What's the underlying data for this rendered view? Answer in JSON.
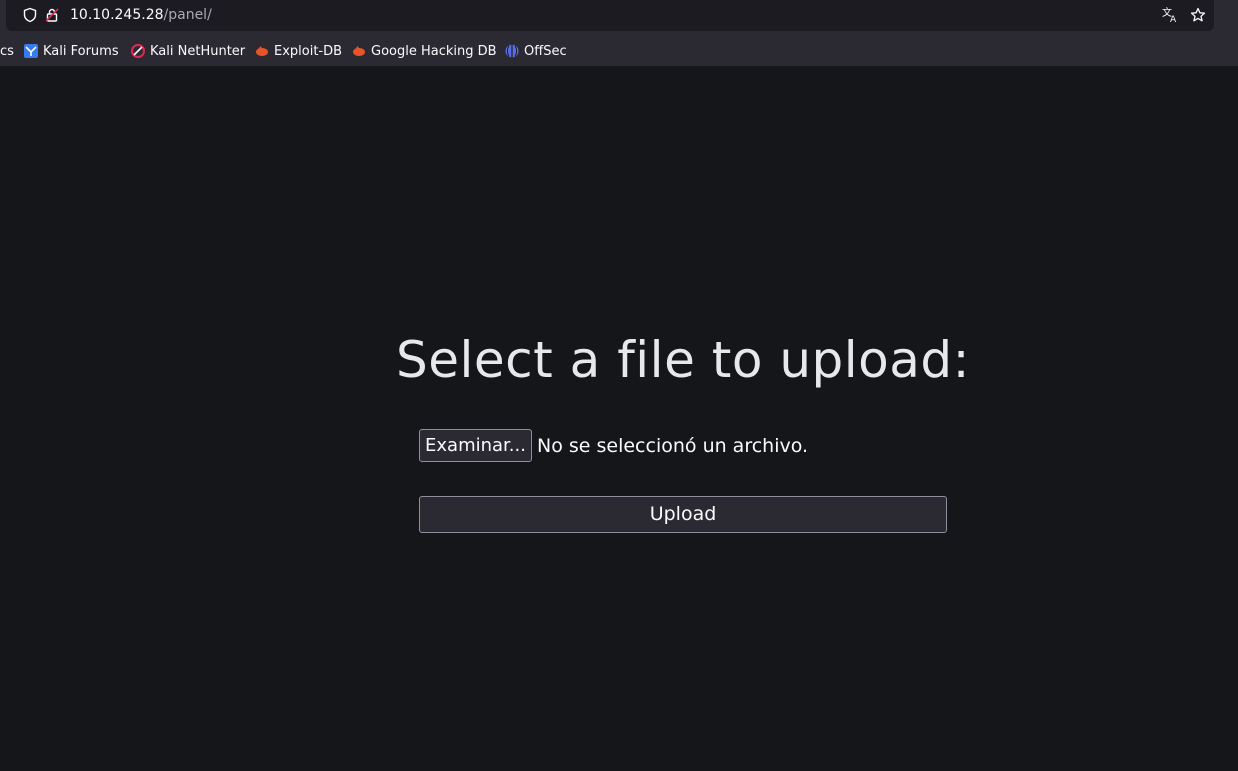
{
  "browser": {
    "url_host": "10.10.245.28",
    "url_path": "/panel/",
    "bookmarks": [
      {
        "label": "cs",
        "icon": "truncated-bookmark"
      },
      {
        "label": "Kali Forums",
        "icon": "kali-dragon-icon"
      },
      {
        "label": "Kali NetHunter",
        "icon": "nethunter-icon"
      },
      {
        "label": "Exploit-DB",
        "icon": "exploit-db-icon"
      },
      {
        "label": "Google Hacking DB",
        "icon": "ghdb-icon"
      },
      {
        "label": "OffSec",
        "icon": "offsec-icon"
      }
    ]
  },
  "page": {
    "heading": "Select a file to upload:",
    "browse_label": "Examinar...",
    "file_status": "No se seleccionó un archivo.",
    "upload_label": "Upload"
  },
  "colors": {
    "page_bg": "#151619",
    "chrome_bg": "#2b2a33",
    "text": "#fbfbfe",
    "exploit_orange": "#e8542a"
  }
}
